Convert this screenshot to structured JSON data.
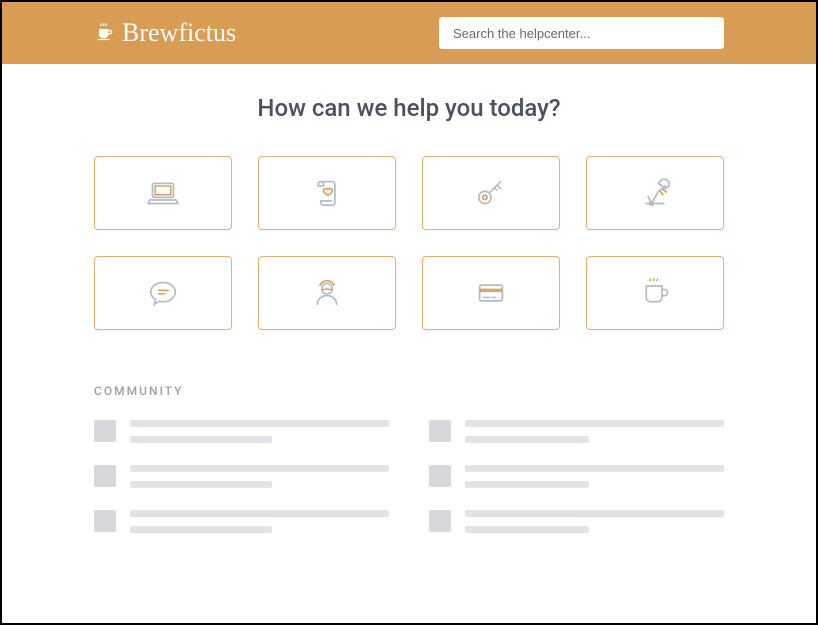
{
  "brand": {
    "name": "Brewfictus",
    "icon": "cup-icon"
  },
  "search": {
    "placeholder": "Search the helpcenter..."
  },
  "page": {
    "title": "How can we help you today?"
  },
  "cards": [
    {
      "icon": "laptop-icon"
    },
    {
      "icon": "scroll-heart-icon"
    },
    {
      "icon": "key-icon"
    },
    {
      "icon": "lamp-icon"
    },
    {
      "icon": "chat-icon"
    },
    {
      "icon": "user-icon"
    },
    {
      "icon": "creditcard-icon"
    },
    {
      "icon": "mug-icon"
    }
  ],
  "sections": {
    "community": {
      "label": "COMMUNITY"
    }
  },
  "colors": {
    "accent": "#d89c53",
    "card_border": "#e8b06b",
    "title": "#4a5261",
    "icon_gray": "#b6bcc6",
    "icon_accent": "#d89c53"
  }
}
